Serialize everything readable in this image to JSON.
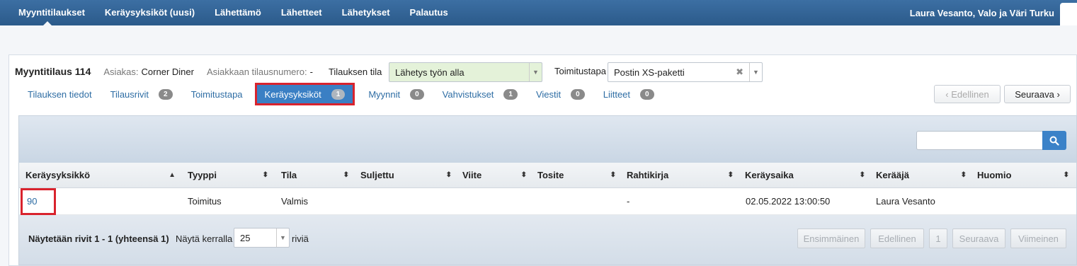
{
  "nav": {
    "items": [
      "Myyntitilaukset",
      "Keräysyksiköt (uusi)",
      "Lähettämö",
      "Lähetteet",
      "Lähetykset",
      "Palautus"
    ],
    "user": "Laura Vesanto, Valo ja Väri Turku"
  },
  "order": {
    "title": "Myyntitilaus 114",
    "customer_label": "Asiakas:",
    "customer_value": "Corner Diner",
    "customer_order_label": "Asiakkaan tilausnumero:",
    "customer_order_value": "-",
    "state_label": "Tilauksen tila",
    "state_value": "Lähetys työn alla",
    "delivery_label": "Toimitustapa",
    "delivery_value": "Postin XS-paketti"
  },
  "tabs": [
    {
      "label": "Tilauksen tiedot",
      "badge": ""
    },
    {
      "label": "Tilausrivit",
      "badge": "2"
    },
    {
      "label": "Toimitustapa",
      "badge": ""
    },
    {
      "label": "Keräysyksiköt",
      "badge": "1"
    },
    {
      "label": "Myynnit",
      "badge": "0"
    },
    {
      "label": "Vahvistukset",
      "badge": "1"
    },
    {
      "label": "Viestit",
      "badge": "0"
    },
    {
      "label": "Liitteet",
      "badge": "0"
    }
  ],
  "pager_top": {
    "prev": "‹ Edellinen",
    "next": "Seuraava ›"
  },
  "table": {
    "columns": [
      "Keräysyksikkö",
      "Tyyppi",
      "Tila",
      "Suljettu",
      "Viite",
      "Tosite",
      "Rahtikirja",
      "Keräysaika",
      "Kerääjä",
      "Huomio"
    ],
    "rows": [
      [
        "90",
        "Toimitus",
        "Valmis",
        "",
        "",
        "",
        "-",
        "02.05.2022 13:00:50",
        "Laura Vesanto",
        ""
      ]
    ]
  },
  "footer": {
    "summary": "Näytetään rivit 1 - 1 (yhteensä 1)",
    "show_label": "Näytä kerralla",
    "page_size": "25",
    "rows_label": "riviä",
    "buttons": [
      "Ensimmäinen",
      "Edellinen",
      "1",
      "Seuraava",
      "Viimeinen"
    ]
  }
}
